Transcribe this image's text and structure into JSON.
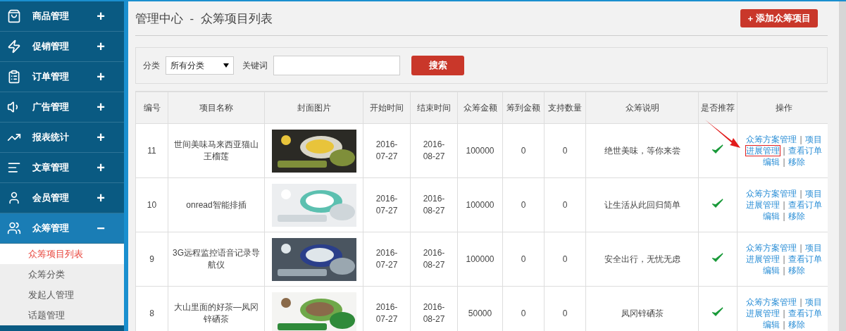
{
  "sidebar": {
    "items": [
      {
        "label": "商品管理",
        "expanded": false,
        "toggle": "+"
      },
      {
        "label": "促销管理",
        "expanded": false,
        "toggle": "+"
      },
      {
        "label": "订单管理",
        "expanded": false,
        "toggle": "+"
      },
      {
        "label": "广告管理",
        "expanded": false,
        "toggle": "+"
      },
      {
        "label": "报表统计",
        "expanded": false,
        "toggle": "+"
      },
      {
        "label": "文章管理",
        "expanded": false,
        "toggle": "+"
      },
      {
        "label": "会员管理",
        "expanded": false,
        "toggle": "+"
      },
      {
        "label": "众筹管理",
        "expanded": true,
        "toggle": "−",
        "children": [
          {
            "label": "众筹项目列表",
            "selected": true
          },
          {
            "label": "众筹分类",
            "selected": false
          },
          {
            "label": "发起人管理",
            "selected": false
          },
          {
            "label": "话题管理",
            "selected": false
          }
        ]
      }
    ]
  },
  "header": {
    "breadcrumb": "管理中心",
    "separator": "-",
    "title": "众筹项目列表",
    "add_button": {
      "icon": "+",
      "label": "添加众筹项目"
    }
  },
  "filter": {
    "category_label": "分类",
    "category_value": "所有分类",
    "keyword_label": "关键词",
    "search_button": "搜索"
  },
  "table": {
    "columns": [
      "编号",
      "项目名称",
      "封面图片",
      "开始时间",
      "结束时间",
      "众筹金额",
      "筹到金额",
      "支持数量",
      "众筹说明",
      "是否推荐",
      "操作"
    ],
    "rows": [
      {
        "id": "11",
        "name": "世间美味马来西亚猫山王榴莲",
        "cover": {
          "kind": "picture"
        },
        "start": "2016-07-27",
        "end": "2016-08-27",
        "goal": "100000",
        "raised": "0",
        "backers": "0",
        "description": "绝世美味，等你来尝",
        "recommended": true,
        "action_lines": [
          {
            "separator": "|",
            "links": [
              {
                "label": "众筹方案管理",
                "highlighted": false
              },
              {
                "label": "项目",
                "highlighted": false
              }
            ]
          },
          {
            "separator": "|",
            "links": [
              {
                "label": "进展管理",
                "highlighted": true
              },
              {
                "label": "查看订单",
                "highlighted": false
              }
            ]
          },
          {
            "separator": "|",
            "links": [
              {
                "label": "编辑",
                "highlighted": false
              },
              {
                "label": "移除",
                "highlighted": false
              }
            ]
          }
        ]
      },
      {
        "id": "10",
        "name": "onread智能排插",
        "cover": {
          "kind": "picture"
        },
        "start": "2016-07-27",
        "end": "2016-08-27",
        "goal": "100000",
        "raised": "0",
        "backers": "0",
        "description": "让生活从此回归简单",
        "recommended": true,
        "action_lines": [
          {
            "separator": "|",
            "links": [
              {
                "label": "众筹方案管理",
                "highlighted": false
              },
              {
                "label": "项目",
                "highlighted": false
              }
            ]
          },
          {
            "separator": "|",
            "links": [
              {
                "label": "进展管理",
                "highlighted": false
              },
              {
                "label": "查看订单",
                "highlighted": false
              }
            ]
          },
          {
            "separator": "|",
            "links": [
              {
                "label": "编辑",
                "highlighted": false
              },
              {
                "label": "移除",
                "highlighted": false
              }
            ]
          }
        ]
      },
      {
        "id": "9",
        "name": "3G远程监控语音记录导航仪",
        "cover": {
          "kind": "picture"
        },
        "start": "2016-07-27",
        "end": "2016-08-27",
        "goal": "100000",
        "raised": "0",
        "backers": "0",
        "description": "安全出行，无忧无虑",
        "recommended": true,
        "action_lines": [
          {
            "separator": "|",
            "links": [
              {
                "label": "众筹方案管理",
                "highlighted": false
              },
              {
                "label": "项目",
                "highlighted": false
              }
            ]
          },
          {
            "separator": "|",
            "links": [
              {
                "label": "进展管理",
                "highlighted": false
              },
              {
                "label": "查看订单",
                "highlighted": false
              }
            ]
          },
          {
            "separator": "|",
            "links": [
              {
                "label": "编辑",
                "highlighted": false
              },
              {
                "label": "移除",
                "highlighted": false
              }
            ]
          }
        ]
      },
      {
        "id": "8",
        "name": "大山里面的好茶—凤冈锌硒茶",
        "cover": {
          "kind": "picture"
        },
        "start": "2016-07-27",
        "end": "2016-08-27",
        "goal": "50000",
        "raised": "0",
        "backers": "0",
        "description": "凤冈锌硒茶",
        "recommended": true,
        "action_lines": [
          {
            "separator": "|",
            "links": [
              {
                "label": "众筹方案管理",
                "highlighted": false
              },
              {
                "label": "项目",
                "highlighted": false
              }
            ]
          },
          {
            "separator": "|",
            "links": [
              {
                "label": "进展管理",
                "highlighted": false
              },
              {
                "label": "查看订单",
                "highlighted": false
              }
            ]
          },
          {
            "separator": "|",
            "links": [
              {
                "label": "编辑",
                "highlighted": false
              },
              {
                "label": "移除",
                "highlighted": false
              }
            ]
          }
        ]
      }
    ]
  }
}
